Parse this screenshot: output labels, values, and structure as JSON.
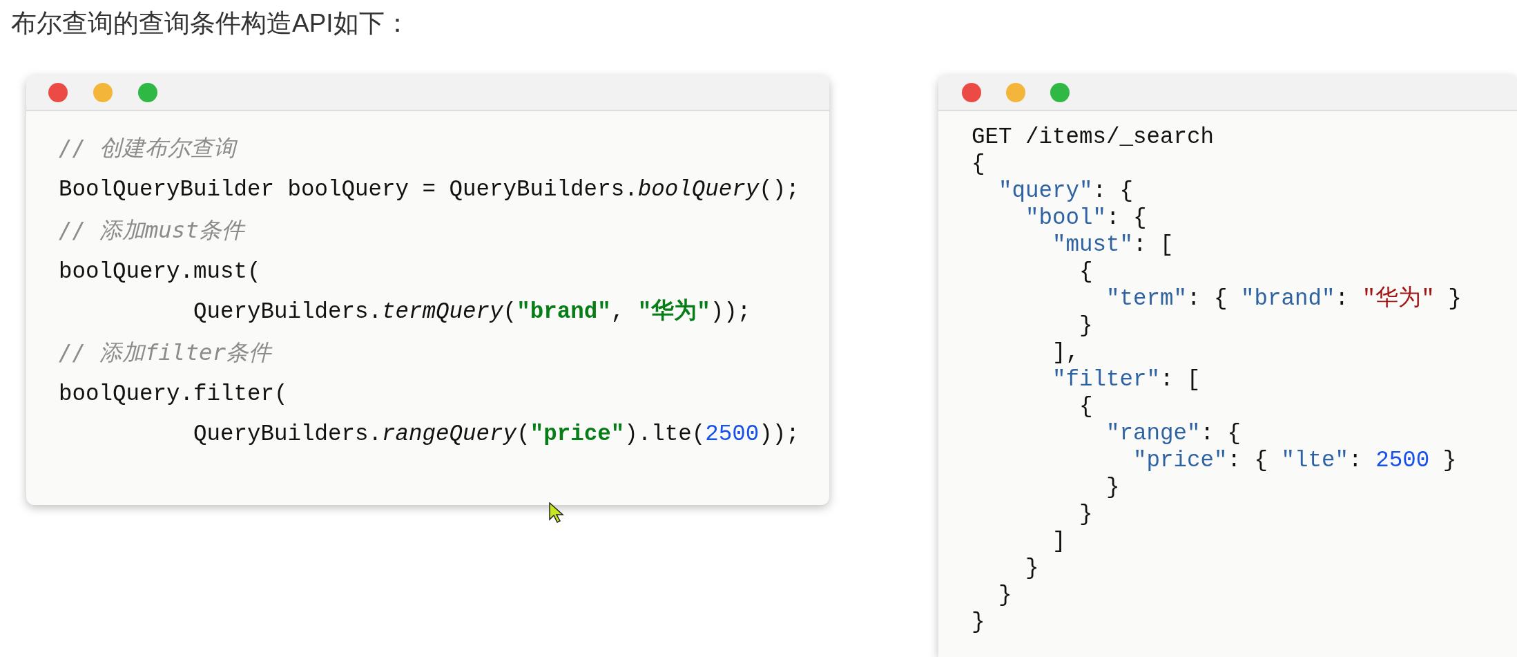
{
  "heading": "布尔查询的查询条件构造API如下：",
  "java_window": {
    "lines": [
      [
        {
          "kind": "comment",
          "text": "// 创建布尔查询"
        }
      ],
      [
        {
          "kind": "plain",
          "text": "BoolQueryBuilder boolQuery = QueryBuilders."
        },
        {
          "kind": "method",
          "text": "boolQuery"
        },
        {
          "kind": "plain",
          "text": "();"
        }
      ],
      [
        {
          "kind": "comment",
          "text": "// 添加must条件"
        }
      ],
      [
        {
          "kind": "plain",
          "text": "boolQuery.must("
        }
      ],
      [
        {
          "kind": "plain",
          "text": "          QueryBuilders."
        },
        {
          "kind": "method",
          "text": "termQuery"
        },
        {
          "kind": "plain",
          "text": "("
        },
        {
          "kind": "string",
          "text": "\"brand\""
        },
        {
          "kind": "plain",
          "text": ", "
        },
        {
          "kind": "string",
          "text": "\"华为\""
        },
        {
          "kind": "plain",
          "text": "));"
        }
      ],
      [
        {
          "kind": "comment",
          "text": "// 添加filter条件"
        }
      ],
      [
        {
          "kind": "plain",
          "text": "boolQuery.filter("
        }
      ],
      [
        {
          "kind": "plain",
          "text": "          QueryBuilders."
        },
        {
          "kind": "method",
          "text": "rangeQuery"
        },
        {
          "kind": "plain",
          "text": "("
        },
        {
          "kind": "string",
          "text": "\"price\""
        },
        {
          "kind": "plain",
          "text": ").lte("
        },
        {
          "kind": "number",
          "text": "2500"
        },
        {
          "kind": "plain",
          "text": "));"
        }
      ]
    ]
  },
  "dsl_window": {
    "lines": [
      [
        {
          "kind": "plain",
          "text": "GET /items/_search"
        }
      ],
      [
        {
          "kind": "plain",
          "text": "{"
        }
      ],
      [
        {
          "kind": "key",
          "text": "  \"query\""
        },
        {
          "kind": "plain",
          "text": ": {"
        }
      ],
      [
        {
          "kind": "key",
          "text": "    \"bool\""
        },
        {
          "kind": "plain",
          "text": ": {"
        }
      ],
      [
        {
          "kind": "key",
          "text": "      \"must\""
        },
        {
          "kind": "plain",
          "text": ": ["
        }
      ],
      [
        {
          "kind": "plain",
          "text": "        {"
        }
      ],
      [
        {
          "kind": "key",
          "text": "          \"term\""
        },
        {
          "kind": "plain",
          "text": ": { "
        },
        {
          "kind": "key",
          "text": "\"brand\""
        },
        {
          "kind": "plain",
          "text": ": "
        },
        {
          "kind": "value",
          "text": "\"华为\""
        },
        {
          "kind": "plain",
          "text": " }"
        }
      ],
      [
        {
          "kind": "plain",
          "text": "        }"
        }
      ],
      [
        {
          "kind": "plain",
          "text": "      ],"
        }
      ],
      [
        {
          "kind": "key",
          "text": "      \"filter\""
        },
        {
          "kind": "plain",
          "text": ": ["
        }
      ],
      [
        {
          "kind": "plain",
          "text": "        {"
        }
      ],
      [
        {
          "kind": "key",
          "text": "          \"range\""
        },
        {
          "kind": "plain",
          "text": ": {"
        }
      ],
      [
        {
          "kind": "key",
          "text": "            \"price\""
        },
        {
          "kind": "plain",
          "text": ": { "
        },
        {
          "kind": "key",
          "text": "\"lte\""
        },
        {
          "kind": "plain",
          "text": ": "
        },
        {
          "kind": "number",
          "text": "2500"
        },
        {
          "kind": "plain",
          "text": " }"
        }
      ],
      [
        {
          "kind": "plain",
          "text": "          }"
        }
      ],
      [
        {
          "kind": "plain",
          "text": "        }"
        }
      ],
      [
        {
          "kind": "plain",
          "text": "      ]"
        }
      ],
      [
        {
          "kind": "plain",
          "text": "    }"
        }
      ],
      [
        {
          "kind": "plain",
          "text": "  }"
        }
      ],
      [
        {
          "kind": "plain",
          "text": "}"
        }
      ]
    ]
  }
}
